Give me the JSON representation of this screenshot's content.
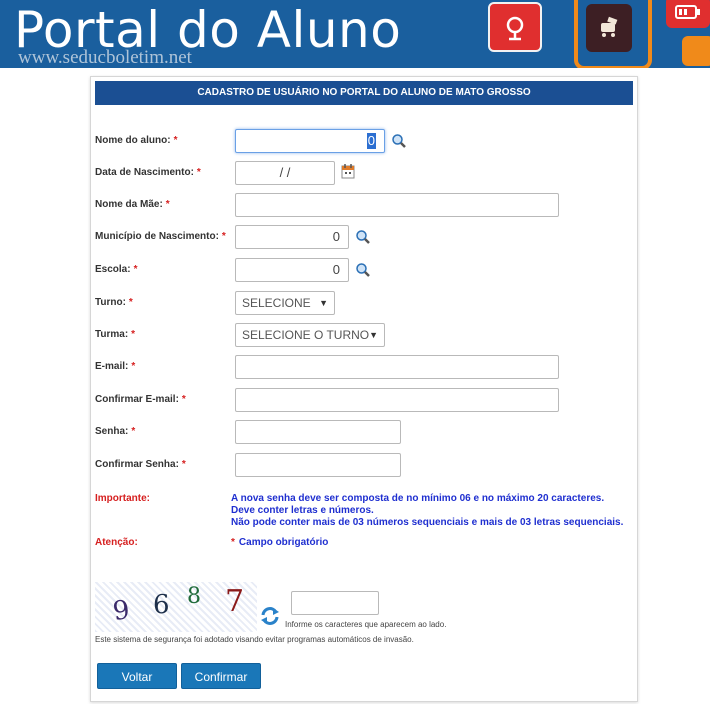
{
  "banner": {
    "title": "Portal do Aluno",
    "url_watermark": "www.seducboletim.net",
    "icons": [
      "satellite-icon",
      "cart-icon",
      "battery-icon"
    ]
  },
  "form": {
    "header": "CADASTRO DE USUÁRIO NO PORTAL DO ALUNO DE MATO GROSSO",
    "required_mark": "*",
    "fields": {
      "nome_aluno": {
        "label": "Nome do aluno:",
        "value": "0"
      },
      "data_nascimento": {
        "label": "Data de Nascimento:",
        "value": "/ /"
      },
      "nome_mae": {
        "label": "Nome da Mãe:",
        "value": ""
      },
      "municipio": {
        "label": "Município de Nascimento:",
        "value": "0"
      },
      "escola": {
        "label": "Escola:",
        "value": "0"
      },
      "turno": {
        "label": "Turno:",
        "selected": "SELECIONE"
      },
      "turma": {
        "label": "Turma:",
        "selected": "SELECIONE O TURNO"
      },
      "email": {
        "label": "E-mail:",
        "value": ""
      },
      "confirmar_email": {
        "label": "Confirmar E-mail:",
        "value": ""
      },
      "senha": {
        "label": "Senha:",
        "value": ""
      },
      "confirmar_senha": {
        "label": "Confirmar Senha:",
        "value": ""
      }
    },
    "importante": {
      "label": "Importante:",
      "lines": [
        "A nova senha deve ser composta de no mínimo 06 e no máximo 20 caracteres.",
        "Deve conter letras e números.",
        "Não pode conter mais de 03 números sequenciais e mais de 03 letras sequenciais."
      ]
    },
    "atencao": {
      "label": "Atenção:",
      "text": "Campo obrigatório"
    },
    "captcha": {
      "characters": [
        "9",
        "6",
        "8",
        "7"
      ],
      "hint": "Informe os caracteres que aparecem ao lado.",
      "security_note": "Este sistema de segurança foi adotado visando evitar programas automáticos de invasão."
    },
    "buttons": {
      "back": "Voltar",
      "confirm": "Confirmar"
    }
  },
  "colors": {
    "banner_bg": "#1a5f9e",
    "header_bg": "#1b4f93",
    "required": "#d62020",
    "info_text": "#1f2fd0",
    "button_bg": "#1a77b8"
  }
}
